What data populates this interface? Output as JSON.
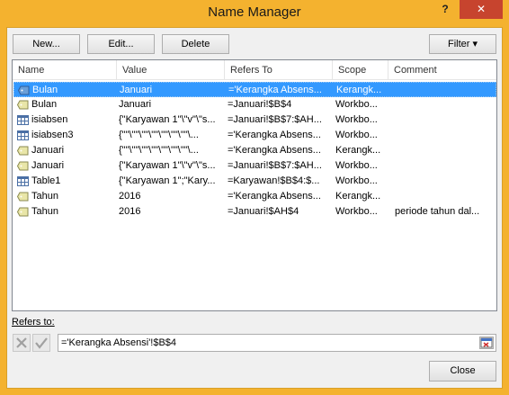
{
  "window": {
    "title": "Name Manager",
    "help_label": "?",
    "close_glyph": "✕"
  },
  "toolbar": {
    "new_label": "New...",
    "edit_label": "Edit...",
    "delete_label": "Delete",
    "filter_label": "Filter ▾"
  },
  "columns": [
    "Name",
    "Value",
    "Refers To",
    "Scope",
    "Comment"
  ],
  "rows": [
    {
      "icon": "named-range-icon",
      "name": "Bulan",
      "value": "Januari",
      "refers_to": "='Kerangka Absens...",
      "scope": "Kerangk...",
      "comment": "",
      "selected": true
    },
    {
      "icon": "named-range-icon",
      "name": "Bulan",
      "value": "Januari",
      "refers_to": "=Januari!$B$4",
      "scope": "Workbo...",
      "comment": "",
      "selected": false
    },
    {
      "icon": "table-icon",
      "name": "isiabsen",
      "value": "{\"Karyawan 1\"\\\"v\"\\\"s...",
      "refers_to": "=Januari!$B$7:$AH...",
      "scope": "Workbo...",
      "comment": "",
      "selected": false
    },
    {
      "icon": "table-icon",
      "name": "isiabsen3",
      "value": "{\"\"\\\"\"\\\"\"\\\"\"\\\"\"\\\"\"\\\"\"\\...",
      "refers_to": "='Kerangka Absens...",
      "scope": "Workbo...",
      "comment": "",
      "selected": false
    },
    {
      "icon": "named-range-icon",
      "name": "Januari",
      "value": "{\"\"\\\"\"\\\"\"\\\"\"\\\"\"\\\"\"\\\"\"\\...",
      "refers_to": "='Kerangka Absens...",
      "scope": "Kerangk...",
      "comment": "",
      "selected": false
    },
    {
      "icon": "named-range-icon",
      "name": "Januari",
      "value": "{\"Karyawan 1\"\\\"v\"\\\"s...",
      "refers_to": "=Januari!$B$7:$AH...",
      "scope": "Workbo...",
      "comment": "",
      "selected": false
    },
    {
      "icon": "table-icon",
      "name": "Table1",
      "value": "{\"Karyawan 1\";\"Kary...",
      "refers_to": "=Karyawan!$B$4:$...",
      "scope": "Workbo...",
      "comment": "",
      "selected": false
    },
    {
      "icon": "named-range-icon",
      "name": "Tahun",
      "value": "2016",
      "refers_to": "='Kerangka Absens...",
      "scope": "Kerangk...",
      "comment": "",
      "selected": false
    },
    {
      "icon": "named-range-icon",
      "name": "Tahun",
      "value": "2016",
      "refers_to": "=Januari!$AH$4",
      "scope": "Workbo...",
      "comment": "periode tahun dal...",
      "selected": false
    }
  ],
  "refers_to": {
    "label": "Refers to:",
    "value": "='Kerangka Absensi'!$B$4"
  },
  "footer": {
    "close_label": "Close"
  },
  "colors": {
    "title_bar": "#f4b22f",
    "close_button": "#c7442e",
    "selection": "#3399ff"
  }
}
